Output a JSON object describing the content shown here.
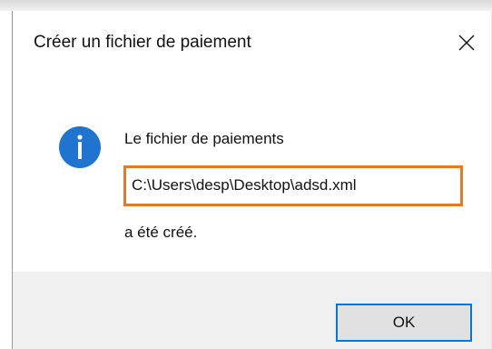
{
  "dialog": {
    "title": "Créer un fichier de paiement",
    "close_icon": "close-icon",
    "info_icon": "info-icon",
    "message_line1": "Le fichier de paiements",
    "file_path": "C:\\Users\\desp\\Desktop\\adsd.xml",
    "message_line3": "a été créé.",
    "ok_label": "OK"
  },
  "colors": {
    "info_icon": "#1f74d0",
    "highlight_border": "#e07b2a",
    "button_focus_border": "#0078d7",
    "footer_background": "#f0f0f0"
  }
}
